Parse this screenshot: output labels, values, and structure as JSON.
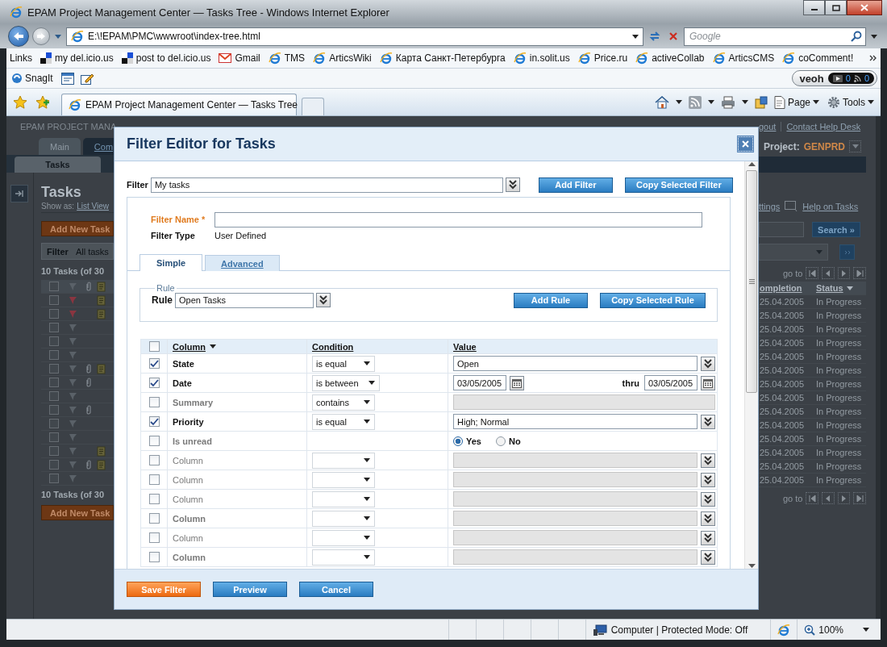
{
  "window": {
    "title": "EPAM Project Management Center — Tasks Tree - Windows Internet Explorer"
  },
  "address_bar": {
    "url": "E:\\!EPAM\\PMC\\wwwroot\\index-tree.html",
    "search_placeholder": "Google"
  },
  "links_bar": {
    "label": "Links",
    "items": [
      {
        "label": "my del.icio.us",
        "kind": "delicious"
      },
      {
        "label": "post to del.icio.us",
        "kind": "delicious"
      },
      {
        "label": "Gmail",
        "kind": "gmail"
      },
      {
        "label": "TMS",
        "kind": "ie"
      },
      {
        "label": "ArticsWiki",
        "kind": "ie"
      },
      {
        "label": "Карта Санкт-Петербурга",
        "kind": "ie"
      },
      {
        "label": "in.solit.us",
        "kind": "ie"
      },
      {
        "label": "Price.ru",
        "kind": "ie"
      },
      {
        "label": "activeCollab",
        "kind": "ie"
      },
      {
        "label": "ArticsCMS",
        "kind": "ie"
      },
      {
        "label": "coComment!",
        "kind": "ie"
      }
    ]
  },
  "toolbar": {
    "snagit": "SnagIt",
    "veoh": "veoh",
    "video_count": "0",
    "feed_count": "0"
  },
  "tabs": [
    {
      "label": "EPAM Project Management Center — Tasks Tree",
      "selected": true
    }
  ],
  "command_bar": {
    "page": "Page",
    "tools": "Tools"
  },
  "page": {
    "header": "EPAM PROJECT MANA",
    "nav_tabs": [
      {
        "label": "Main",
        "selected": false
      },
      {
        "label": "Com",
        "selected": true
      }
    ],
    "subtab": "Tasks",
    "title": "Tasks",
    "show_as": "Show as:",
    "view_link": "List View",
    "add_task": "Add New Task",
    "filter_label": "Filter",
    "filter_value": "All tasks",
    "count_top": "10 Tasks (of 30",
    "count_bottom": "10 Tasks (of 30",
    "add_task_bottom": "Add New Task",
    "logout": "gout",
    "help_desk": "Contact Help Desk",
    "project_label": "Project:",
    "project": "GENPRD",
    "settings": "ttings",
    "help_tasks": "Help on Tasks",
    "search": "Search »",
    "go_to_top": "go to",
    "go_to_bottom": "go to",
    "completion_header": "ompletion",
    "status_header": "Status",
    "all_checked": false,
    "tasks": [
      {
        "checked": false,
        "flagged": true,
        "attachment": false,
        "note": true,
        "completion": "25.04.2005",
        "status": "In Progress"
      },
      {
        "checked": false,
        "flagged": true,
        "attachment": false,
        "note": true,
        "completion": "25.04.2005",
        "status": "In Progress"
      },
      {
        "checked": false,
        "flagged": false,
        "attachment": false,
        "note": false,
        "completion": "25.04.2005",
        "status": "In Progress"
      },
      {
        "checked": false,
        "flagged": false,
        "attachment": false,
        "note": false,
        "completion": "25.04.2005",
        "status": "In Progress"
      },
      {
        "checked": false,
        "flagged": false,
        "attachment": false,
        "note": false,
        "completion": "25.04.2005",
        "status": "In Progress"
      },
      {
        "checked": false,
        "flagged": false,
        "attachment": true,
        "note": true,
        "completion": "25.04.2005",
        "status": "In Progress"
      },
      {
        "checked": false,
        "flagged": false,
        "attachment": true,
        "note": false,
        "completion": "25.04.2005",
        "status": "In Progress"
      },
      {
        "checked": false,
        "flagged": false,
        "attachment": false,
        "note": false,
        "completion": "25.04.2005",
        "status": "In Progress"
      },
      {
        "checked": false,
        "flagged": false,
        "attachment": true,
        "note": false,
        "completion": "25.04.2005",
        "status": "In Progress"
      },
      {
        "checked": false,
        "flagged": false,
        "attachment": false,
        "note": false,
        "completion": "25.04.2005",
        "status": "In Progress"
      },
      {
        "checked": false,
        "flagged": false,
        "attachment": false,
        "note": false,
        "completion": "25.04.2005",
        "status": "In Progress"
      },
      {
        "checked": false,
        "flagged": false,
        "attachment": false,
        "note": true,
        "completion": "25.04.2005",
        "status": "In Progress"
      },
      {
        "checked": false,
        "flagged": false,
        "attachment": true,
        "note": true,
        "completion": "25.04.2005",
        "status": "In Progress"
      },
      {
        "checked": false,
        "flagged": false,
        "attachment": false,
        "note": false,
        "completion": "25.04.2005",
        "status": "In Progress"
      }
    ]
  },
  "dialog": {
    "title": "Filter Editor for Tasks",
    "filter_label": "Filter",
    "filter_value": "My tasks",
    "add_filter": "Add Filter",
    "copy_filter": "Copy Selected Filter",
    "name_label": "Filter Name *",
    "type_label": "Filter Type",
    "type_value": "User Defined",
    "tabs": [
      {
        "label": "Simple",
        "selected": true
      },
      {
        "label": "Advanced",
        "selected": false
      }
    ],
    "rule_legend": "Rule",
    "rule_label": "Rule",
    "rule_value": "Open Tasks",
    "add_rule": "Add Rule",
    "copy_rule": "Copy Selected Rule",
    "table": {
      "columns": [
        "Column",
        "Condition",
        "Value"
      ],
      "all_checked": false,
      "rows": [
        {
          "column": "State",
          "checked": true,
          "bold": true,
          "kind": "dropdown",
          "condition": "is equal",
          "value": "Open",
          "disabled": false
        },
        {
          "column": "Date",
          "checked": true,
          "bold": true,
          "kind": "date_range",
          "condition": "is between",
          "from": "03/05/2005",
          "thru": "thru",
          "to": "03/05/2005",
          "disabled": false
        },
        {
          "column": "Summary",
          "checked": false,
          "bold": true,
          "kind": "text",
          "condition": "contains",
          "disabled": true
        },
        {
          "column": "Priority",
          "checked": true,
          "bold": true,
          "kind": "dropdown",
          "condition": "is equal",
          "value": "High; Normal",
          "disabled": false
        },
        {
          "column": "Is unread",
          "checked": false,
          "bold": true,
          "kind": "radio",
          "options": [
            {
              "label": "Yes",
              "selected": true
            },
            {
              "label": "No",
              "selected": false
            }
          ]
        },
        {
          "column": "Column",
          "checked": false,
          "bold": false,
          "kind": "dropdown",
          "disabled": true
        },
        {
          "column": "Column",
          "checked": false,
          "bold": false,
          "kind": "dropdown",
          "disabled": true
        },
        {
          "column": "Column",
          "checked": false,
          "bold": false,
          "kind": "dropdown",
          "disabled": true
        },
        {
          "column": "Column",
          "checked": false,
          "bold": true,
          "kind": "dropdown",
          "disabled": true
        },
        {
          "column": "Column",
          "checked": false,
          "bold": false,
          "kind": "dropdown",
          "disabled": true
        },
        {
          "column": "Column",
          "checked": false,
          "bold": true,
          "kind": "dropdown",
          "disabled": true
        }
      ]
    },
    "buttons": [
      {
        "label": "Save Filter",
        "kind": "primary"
      },
      {
        "label": "Preview",
        "kind": "secondary"
      },
      {
        "label": "Cancel",
        "kind": "secondary"
      }
    ]
  },
  "status_bar": {
    "zone": "Computer | Protected Mode: Off",
    "zoom": "100%"
  }
}
